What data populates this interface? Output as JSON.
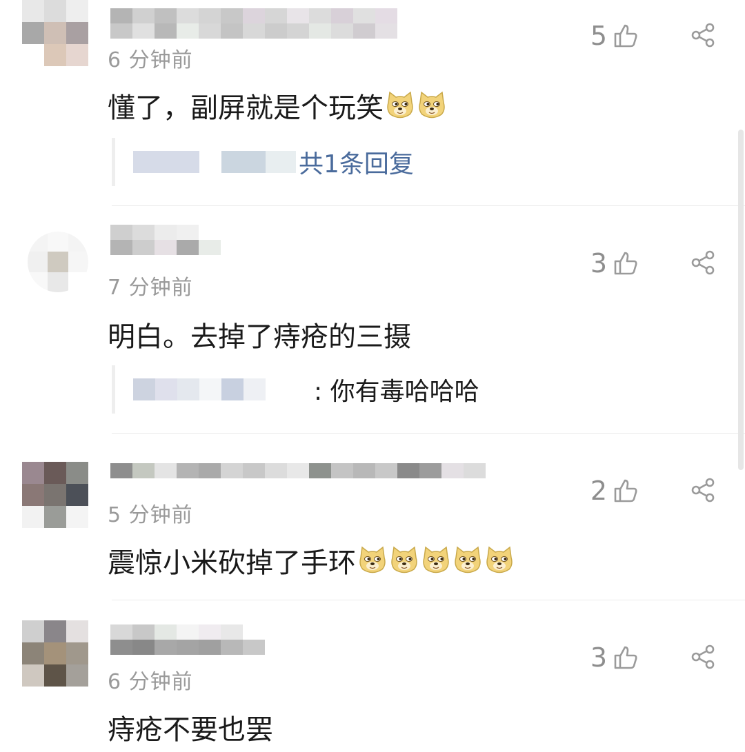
{
  "comments": [
    {
      "time": "6 分钟前",
      "likes": "5",
      "text": "懂了，副屏就是个玩笑",
      "reply_link": "共1条回复"
    },
    {
      "time": "7 分钟前",
      "likes": "3",
      "text": "明白。去掉了痔疮的三摄",
      "reply_text": ": 你有毒哈哈哈"
    },
    {
      "time": "5 分钟前",
      "likes": "2",
      "text": "震惊小米砍掉了手环"
    },
    {
      "time": "6 分钟前",
      "likes": "3",
      "text": "痔疮不要也罢"
    }
  ],
  "icons": {
    "like": "thumbs-up-icon",
    "share": "share-icon",
    "emoji": "doge-emoji-icon"
  },
  "colors": {
    "reply_link": "#4a6b9c",
    "meta_gray": "#9a9a9a"
  }
}
